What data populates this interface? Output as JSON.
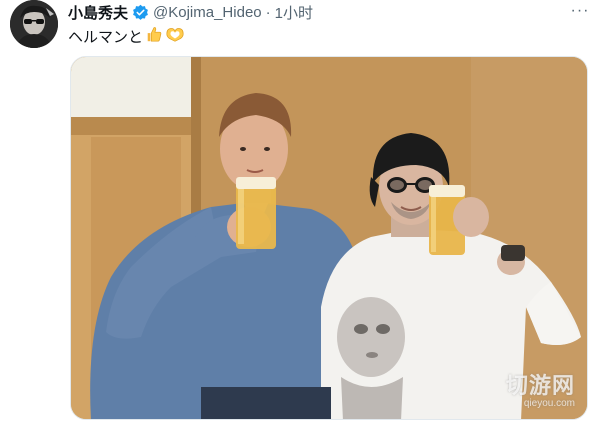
{
  "tweet": {
    "author": {
      "display_name": "小島秀夫",
      "handle": "@Kojima_Hideo",
      "verified": true
    },
    "separator": "·",
    "time": "1小时",
    "text": "ヘルマンと",
    "emojis": [
      "thumbs-up",
      "heart-hands"
    ],
    "more_label": "···"
  },
  "media": {
    "description": "",
    "watermark": {
      "main": "切游网",
      "sub": "qieyou.com"
    }
  },
  "colors": {
    "verified": "#1d9bf0",
    "secondary_text": "#536471",
    "primary_text": "#0f1419"
  }
}
